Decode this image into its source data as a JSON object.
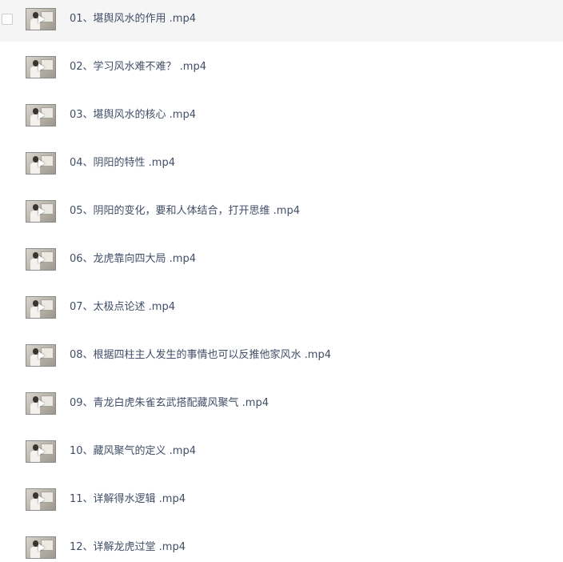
{
  "files": [
    {
      "name": "01、堪舆风水的作用 .mp4",
      "hovered": true
    },
    {
      "name": "02、学习风水难不难？ .mp4"
    },
    {
      "name": "03、堪舆风水的核心 .mp4"
    },
    {
      "name": "04、阴阳的特性 .mp4"
    },
    {
      "name": "05、阴阳的变化，要和人体结合，打开思维 .mp4"
    },
    {
      "name": "06、龙虎靠向四大局 .mp4"
    },
    {
      "name": "07、太极点论述 .mp4"
    },
    {
      "name": "08、根据四柱主人发生的事情也可以反推他家风水 .mp4"
    },
    {
      "name": "09、青龙白虎朱雀玄武搭配藏风聚气 .mp4"
    },
    {
      "name": "10、藏风聚气的定义 .mp4"
    },
    {
      "name": "11、详解得水逻辑 .mp4"
    },
    {
      "name": "12、详解龙虎过堂 .mp4"
    }
  ],
  "icons": {
    "thumbnail": "video-thumbnail-icon",
    "play": "play-icon",
    "checkbox": "checkbox-icon"
  }
}
